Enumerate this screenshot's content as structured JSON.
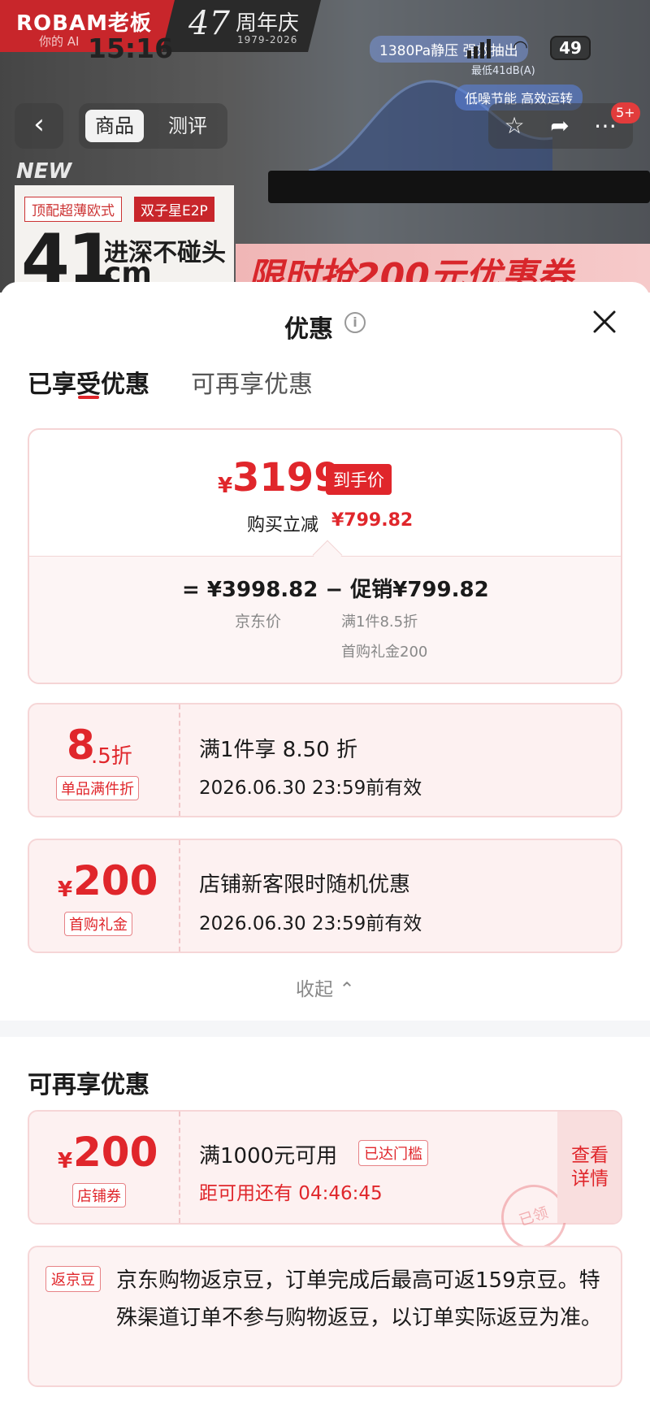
{
  "status_bar": {
    "time": "15:16",
    "battery": "49"
  },
  "banner": {
    "brand": "ROBAM老板",
    "brand_sub": "你的 AI",
    "anniversary_number": "47",
    "anniversary_label": "周年庆",
    "anniversary_years": "1979-2026",
    "feature_1": "1380Pa静压 强效抽出",
    "feature_2": "低噪节能 高效运转",
    "feature_3": "最低41dB(A)",
    "new_label": "NEW",
    "tag_1": "顶配超薄欧式",
    "tag_2": "双子星E2P",
    "big_number": "41",
    "big_caption": "进深不碰头",
    "big_unit": "cm",
    "sale_text": "限时抢200元优惠券"
  },
  "nav": {
    "tabs": [
      "商品",
      "测评"
    ],
    "badge": "5+"
  },
  "sheet": {
    "title": "优惠",
    "tabs": {
      "enjoyed": "已享受优惠",
      "more": "可再享优惠"
    },
    "summary": {
      "currency": "¥",
      "final_price": "3199",
      "final_price_tag": "到手价",
      "reduce_label": "购买立减",
      "reduce_value": "¥799.82",
      "equation": "=  ¥3998.82  −  促销¥799.82",
      "jd_price_label": "京东价",
      "promo_note_1": "满1件8.5折",
      "promo_note_2": "首购礼金200"
    },
    "coupon_discount": {
      "value_main": "8",
      "value_tail": ".5折",
      "label": "单品满件折",
      "title": "满1件享 8.50 折",
      "validity": "2026.06.30 23:59前有效"
    },
    "coupon_gift": {
      "currency": "¥",
      "value": "200",
      "label": "首购礼金",
      "title": "店铺新客限时随机优惠",
      "validity": "2026.06.30 23:59前有效"
    },
    "collapse_label": "收起",
    "more_section_title": "可再享优惠",
    "coupon_store": {
      "currency": "¥",
      "value": "200",
      "label": "店铺券",
      "title": "满1000元可用",
      "threshold_tag": "已达门槛",
      "countdown": "距可用还有 04:46:45",
      "detail_label": "查看详情",
      "stamp": "已领"
    },
    "bean": {
      "tag": "返京豆",
      "text": "京东购物返京豆，订单完成后最高可返159京豆。特殊渠道订单不参与购物返豆，以订单实际返豆为准。"
    }
  },
  "colors": {
    "accent": "#e0262b",
    "card_bg": "#fdf1f1",
    "card_border": "#f6d6d7"
  }
}
